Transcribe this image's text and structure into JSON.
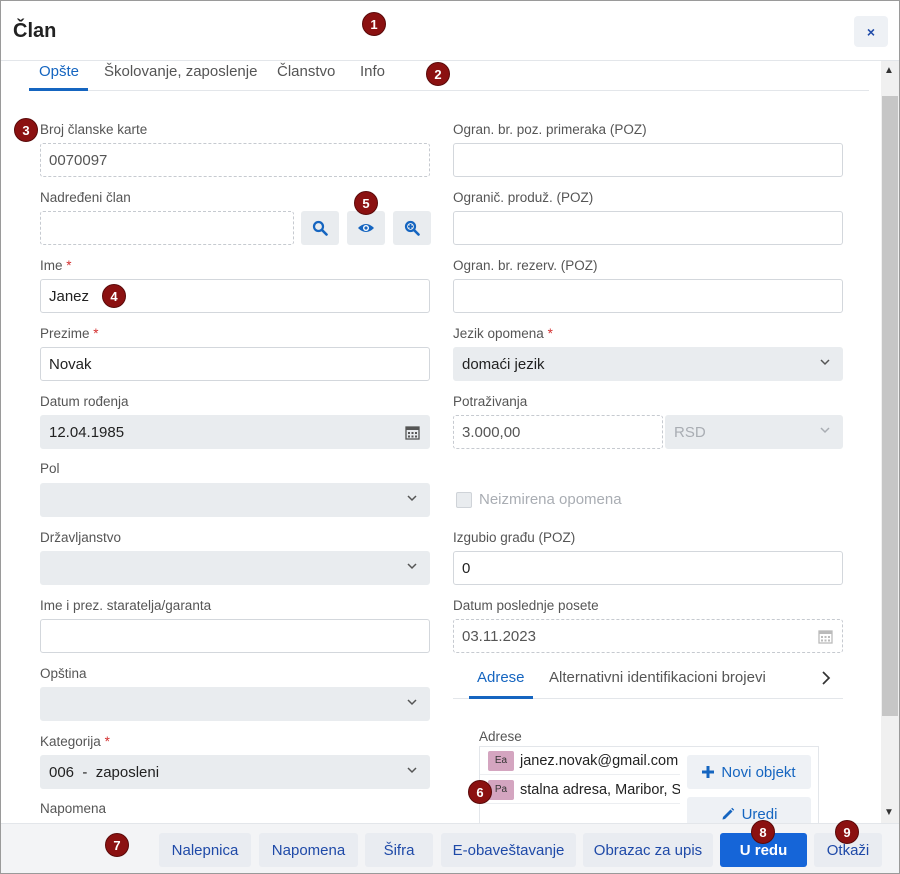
{
  "dialog": {
    "title": "Član",
    "close_glyph": "×"
  },
  "tabs": [
    {
      "label": "Opšte",
      "active": true
    },
    {
      "label": "Školovanje, zaposlenje",
      "active": false
    },
    {
      "label": "Članstvo",
      "active": false
    },
    {
      "label": "Info",
      "active": false
    }
  ],
  "badges": [
    "1",
    "2",
    "3",
    "4",
    "5",
    "6",
    "7",
    "8",
    "9"
  ],
  "left": {
    "broj_label": "Broj članske karte",
    "broj_value": "0070097",
    "nadredjeni_label": "Nadređeni član",
    "nadredjeni_value": "",
    "ime_label": "Ime",
    "ime_value": "Janez",
    "prezime_label": "Prezime",
    "prezime_value": "Novak",
    "datum_label": "Datum rođenja",
    "datum_value": "12.04.1985",
    "pol_label": "Pol",
    "pol_value": "",
    "drzavljanstvo_label": "Državljanstvo",
    "drzavljanstvo_value": "",
    "staratelj_label": "Ime i prez. staratelja/garanta",
    "staratelj_value": "",
    "opstina_label": "Opština",
    "opstina_value": "",
    "kategorija_label": "Kategorija",
    "kategorija_value": "006  -  zaposleni",
    "napomena_label": "Napomena",
    "required_mark": "*"
  },
  "right": {
    "ogran_primeraka_label": "Ogran. br. poz. primeraka (POZ)",
    "ogran_primeraka_value": "",
    "ogran_produz_label": "Ogranič. produž. (POZ)",
    "ogran_produz_value": "",
    "ogran_rezerv_label": "Ogran. br. rezerv. (POZ)",
    "ogran_rezerv_value": "",
    "jezik_label": "Jezik opomena",
    "jezik_value": "domaći jezik",
    "potrazivanja_label": "Potraživanja",
    "potrazivanja_value": "3.000,00",
    "currency_value": "RSD",
    "neizmirena_label": "Neizmirena opomena",
    "izgubio_label": "Izgubio građu (POZ)",
    "izgubio_value": "0",
    "poseta_label": "Datum poslednje posete",
    "poseta_value": "03.11.2023"
  },
  "subtabs": [
    {
      "label": "Adrese",
      "active": true
    },
    {
      "label": "Alternativni identifikacioni brojevi",
      "active": false
    }
  ],
  "addresses": {
    "label": "Adrese",
    "rows": [
      {
        "tag": "Ea",
        "text": "janez.novak@gmail.com"
      },
      {
        "tag": "Pa",
        "text": "stalna adresa, Maribor, S"
      }
    ],
    "new_button": "Novi objekt",
    "edit_button": "Uredi"
  },
  "footer": {
    "buttons": [
      "Nalepnica",
      "Napomena",
      "Šifra",
      "E-obaveštavanje",
      "Obrazac za upis",
      "U redu",
      "Otkaži"
    ]
  },
  "colors": {
    "accent": "#1565d8",
    "badge": "#8b1111",
    "required": "#d32f2f"
  }
}
